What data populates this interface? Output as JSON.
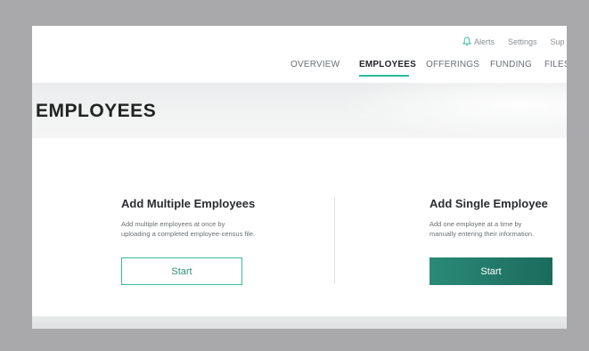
{
  "utility_nav": {
    "alerts": "Alerts",
    "settings": "Settings",
    "support": "Sup"
  },
  "main_nav": {
    "tabs": [
      {
        "label": "OVERVIEW",
        "active": false
      },
      {
        "label": "EMPLOYEES",
        "active": true
      },
      {
        "label": "OFFERINGS",
        "active": false
      },
      {
        "label": "FUNDING",
        "active": false
      },
      {
        "label": "FILES",
        "active": false
      }
    ]
  },
  "page": {
    "title": "EMPLOYEES"
  },
  "cards": {
    "multiple": {
      "title": "Add Multiple Employees",
      "desc_line1": "Add multiple employees at once by",
      "desc_line2": "uploading a completed employee-census file.",
      "button": "Start"
    },
    "single": {
      "title": "Add Single Employee",
      "desc_line1": "Add one employee at a time by",
      "desc_line2": "manually entering their information.",
      "button": "Start"
    }
  },
  "colors": {
    "accent": "#2bb79b",
    "primary_button": "#1c6b5c",
    "outer_background": "#a9a9ab"
  },
  "icons": {
    "alerts": "bell-icon"
  }
}
